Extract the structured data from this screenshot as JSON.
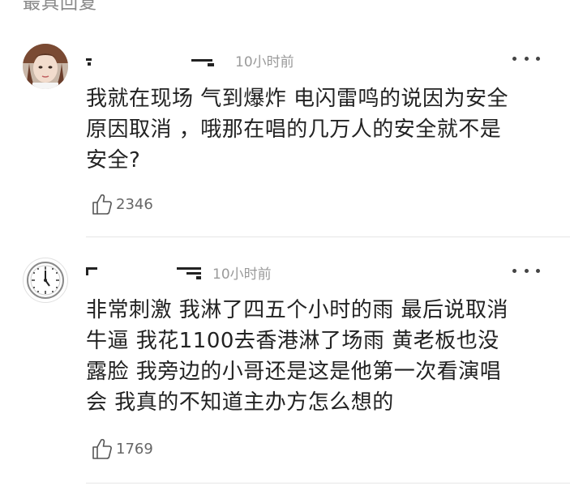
{
  "section": {
    "title": "最具回复"
  },
  "comments": [
    {
      "username": "",
      "time": "10小时前",
      "text": "我就在现场 气到爆炸 电闪雷鸣的说因为安全\n原因取消 ，哦那在唱的几万人的安全就不是\n安全?",
      "likes": "2346",
      "avatar_icon": "portrait-avatar",
      "more_icon": "more-dots-icon",
      "like_icon": "thumb-up-icon"
    },
    {
      "username": "",
      "time": "10小时前",
      "text": "非常刺激 我淋了四五个小时的雨 最后说取消\n牛逼 我花1100去香港淋了场雨 黄老板也没\n露脸 我旁边的小哥还是这是他第一次看演唱\n会 我真的不知道主办方怎么想的",
      "likes": "1769",
      "avatar_icon": "clock-avatar",
      "more_icon": "more-dots-icon",
      "like_icon": "thumb-up-icon"
    }
  ],
  "colors": {
    "text": "#222222",
    "muted": "#9a9a9a",
    "divider": "#e6e6e6"
  }
}
